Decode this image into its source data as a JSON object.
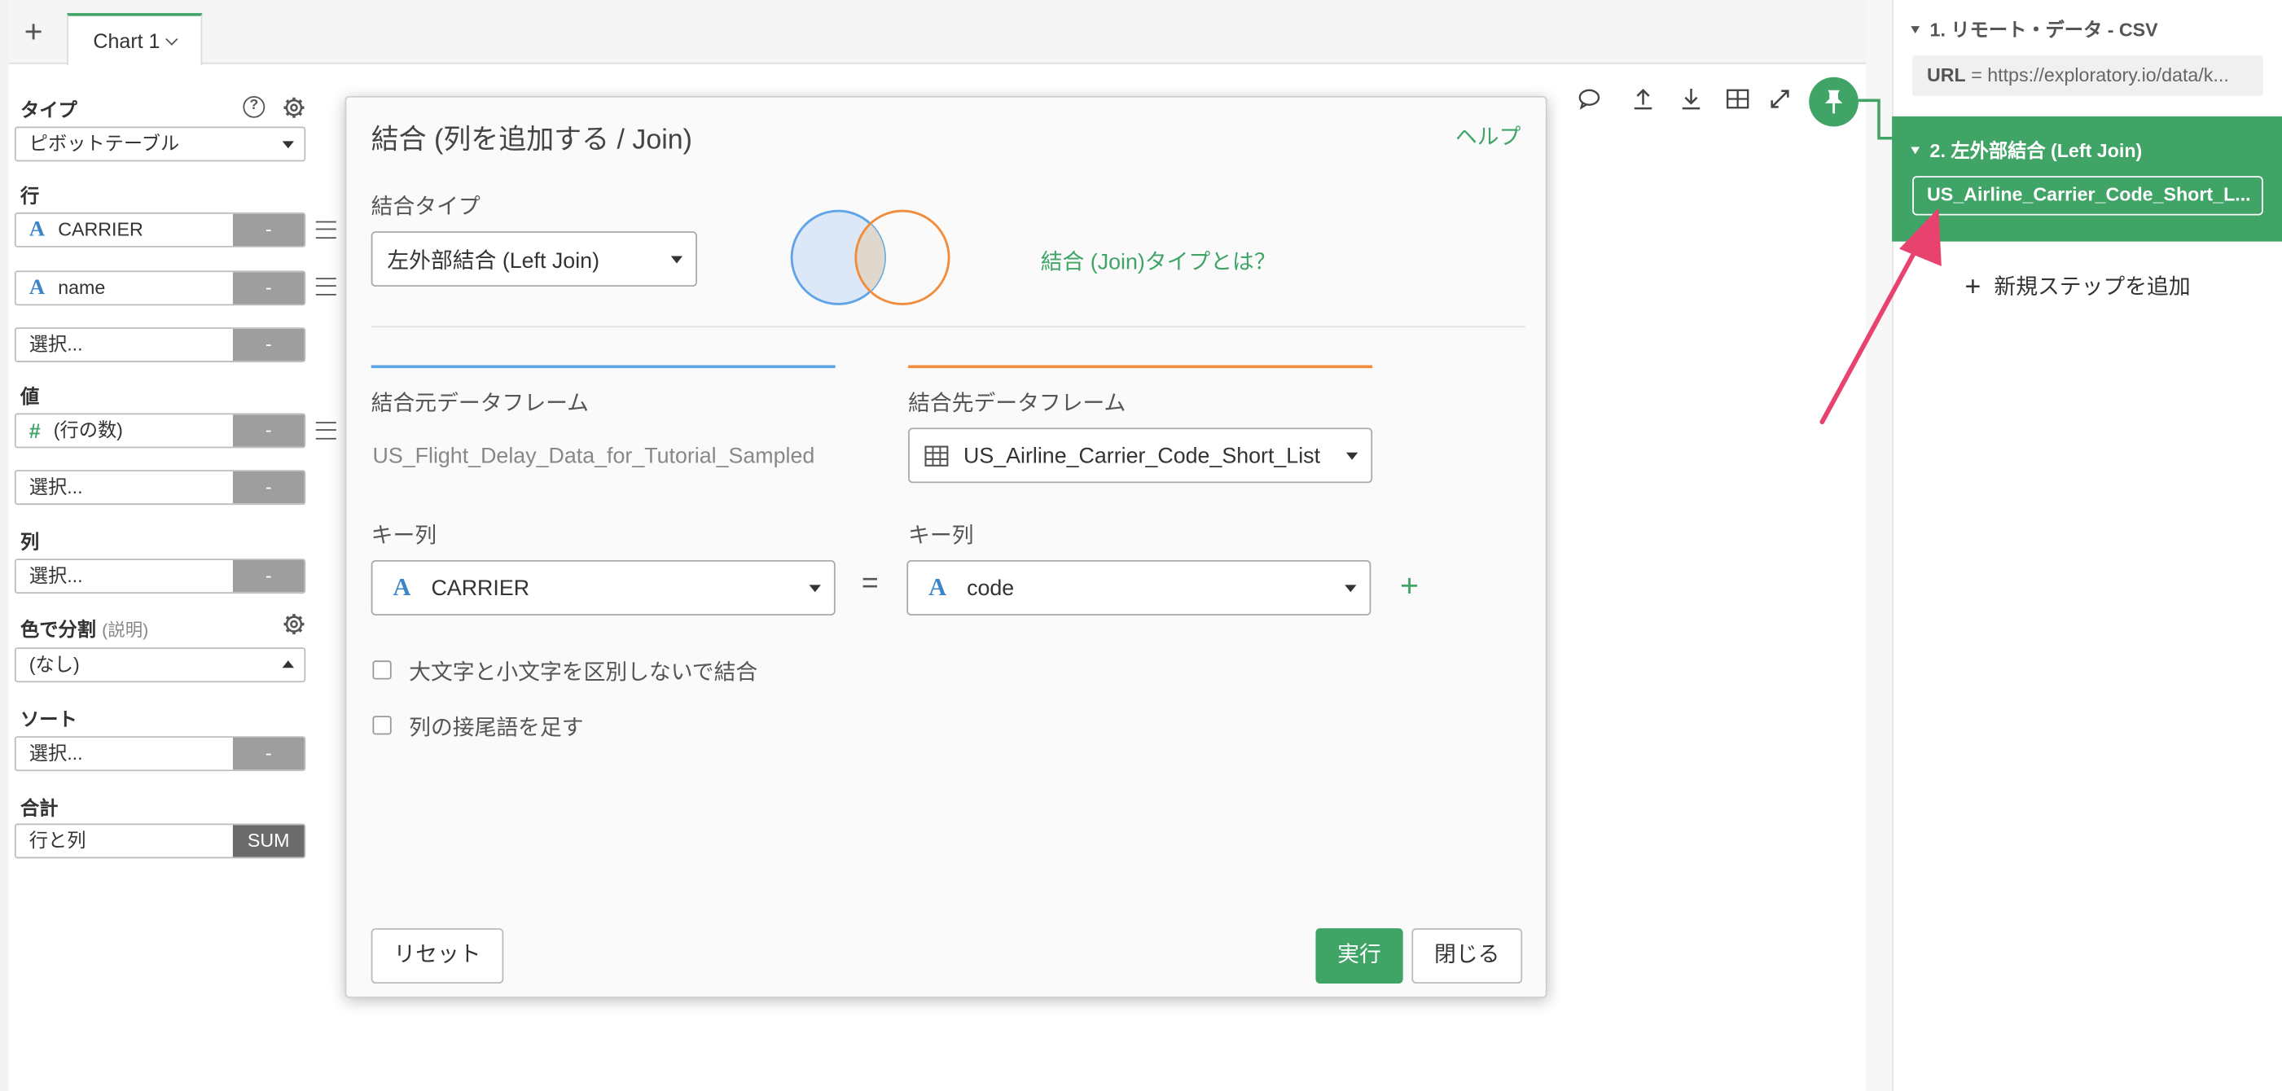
{
  "tabs": {
    "add_tab": "+",
    "chart_tab": "Chart 1"
  },
  "left_panel": {
    "type_label": "タイプ",
    "type_value": "ピボットテーブル",
    "rows_label": "行",
    "rows": [
      {
        "icon": "A",
        "name": "CARRIER",
        "action": "-"
      },
      {
        "icon": "A",
        "name": "name",
        "action": "-"
      },
      {
        "name": "選択...",
        "action": "-"
      }
    ],
    "values_label": "値",
    "values": [
      {
        "icon": "#",
        "name": "(行の数)",
        "action": "-"
      },
      {
        "name": "選択...",
        "action": "-"
      }
    ],
    "cols_label": "列",
    "cols": [
      {
        "name": "選択...",
        "action": "-"
      }
    ],
    "color_label": "色で分割",
    "color_sub": "(説明)",
    "color_value": "(なし)",
    "sort_label": "ソート",
    "sort": {
      "name": "選択...",
      "action": "-"
    },
    "total_label": "合計",
    "total": {
      "name": "行と列",
      "action": "SUM"
    }
  },
  "dialog": {
    "title": "結合 (列を追加する / Join)",
    "help": "ヘルプ",
    "join_type_label": "結合タイプ",
    "join_type_value": "左外部結合 (Left Join)",
    "join_type_link": "結合 (Join)タイプとは？",
    "source_label": "結合元データフレーム",
    "source_value": "US_Flight_Delay_Data_for_Tutorial_Sampled",
    "target_label": "結合先データフレーム",
    "target_value": "US_Airline_Carrier_Code_Short_List",
    "key_left_label": "キー列",
    "key_left_icon": "A",
    "key_left_value": "CARRIER",
    "equals": "=",
    "key_right_label": "キー列",
    "key_right_icon": "A",
    "key_right_value": "code",
    "add_key": "+",
    "ignore_case_label": "大文字と小文字を区別しないで結合",
    "suffix_label": "列の接尾語を足す",
    "reset_button": "リセット",
    "run_button": "実行",
    "close_button": "閉じる"
  },
  "steps": [
    {
      "title": "1. リモート・データ - CSV",
      "detail_key": "URL",
      "detail_value": " = https://exploratory.io/data/k..."
    },
    {
      "title": "2. 左外部結合 (Left Join)",
      "detail": "US_Airline_Carrier_Code_Short_L..."
    }
  ],
  "add_step": "新規ステップを追加",
  "colors": {
    "accent": "#3fa466",
    "left_circle": "#5fa4e6",
    "right_circle": "#f08c3c",
    "arrow": "#e8436e"
  },
  "icons": [
    "comment-icon",
    "upload-icon",
    "download-icon",
    "table-icon",
    "expand-icon",
    "pin-icon",
    "help-icon",
    "gear-icon",
    "table-grid-icon"
  ]
}
